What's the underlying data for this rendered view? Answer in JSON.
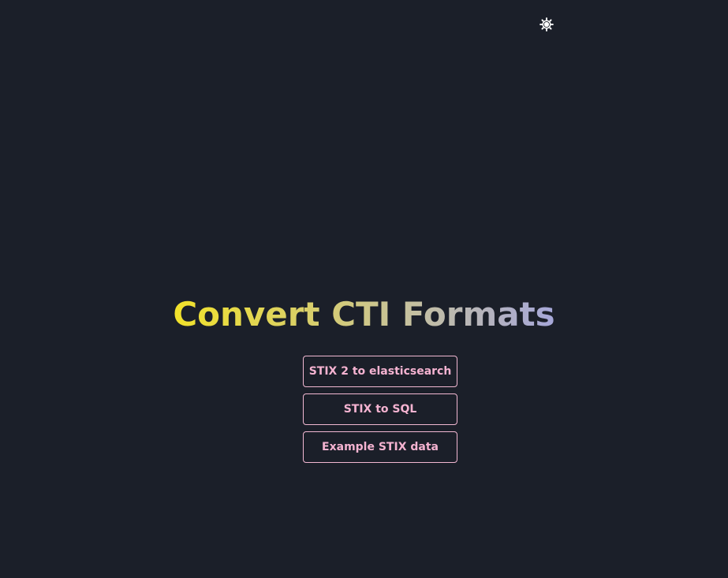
{
  "header": {
    "theme_toggle_icon": "sun-icon"
  },
  "hero": {
    "title": "Convert CTI Formats",
    "title_gradient": [
      "#f2e22a",
      "#d9cf69",
      "#c7c29c",
      "#a6a7d9"
    ]
  },
  "links": [
    {
      "label": "STIX 2 to elasticsearch"
    },
    {
      "label": "STIX to SQL"
    },
    {
      "label": "Example STIX data"
    }
  ],
  "colors": {
    "background": "#1b1f29",
    "link_accent": "#f5b3d1",
    "icon": "#ffffff"
  }
}
